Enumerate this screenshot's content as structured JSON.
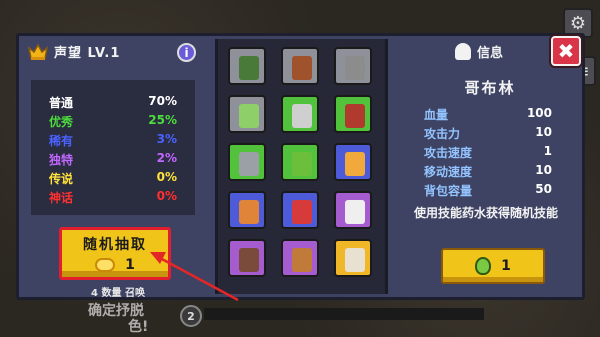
{
  "reputation": {
    "title": "声望 LV.1",
    "info_icon": "info-icon"
  },
  "rarities": [
    {
      "name": "普通",
      "value": "70%",
      "name_color": "#ffffff",
      "value_color": "#ffffff"
    },
    {
      "name": "优秀",
      "value": "25%",
      "name_color": "#4cdc3c",
      "value_color": "#4cdc3c"
    },
    {
      "name": "稀有",
      "value": "3%",
      "name_color": "#4a62ff",
      "value_color": "#4a62ff"
    },
    {
      "name": "独特",
      "value": "2%",
      "name_color": "#c267ff",
      "value_color": "#c267ff"
    },
    {
      "name": "传说",
      "value": "0%",
      "name_color": "#ffe23a",
      "value_color": "#ffe23a"
    },
    {
      "name": "神话",
      "value": "0%",
      "name_color": "#ff3030",
      "value_color": "#ff3030"
    }
  ],
  "draw_button": {
    "label": "随机抽取",
    "cost": "1"
  },
  "summon_note": "4 数量 召唤",
  "grid": [
    {
      "rarity": "gray",
      "sprite": "#4a7a3a"
    },
    {
      "rarity": "gray",
      "sprite": "#a0522d"
    },
    {
      "rarity": "gray",
      "sprite": "#8c8c8c"
    },
    {
      "rarity": "gray",
      "sprite": "#8fcf6a"
    },
    {
      "rarity": "green",
      "sprite": "#cfcfcf"
    },
    {
      "rarity": "green",
      "sprite": "#b03a2e"
    },
    {
      "rarity": "green",
      "sprite": "#9aa0a6"
    },
    {
      "rarity": "green",
      "sprite": "#6bbf3a"
    },
    {
      "rarity": "blue",
      "sprite": "#f2a93b"
    },
    {
      "rarity": "blue",
      "sprite": "#e0843a"
    },
    {
      "rarity": "blue",
      "sprite": "#d63a3a"
    },
    {
      "rarity": "purple",
      "sprite": "#efefef"
    },
    {
      "rarity": "purple",
      "sprite": "#7a4a3a"
    },
    {
      "rarity": "purple",
      "sprite": "#c07a3a"
    },
    {
      "rarity": "gold",
      "sprite": "#e8e0d0"
    }
  ],
  "info": {
    "title": "信息",
    "name": "哥布林",
    "stats": [
      {
        "label": "血量",
        "value": "100"
      },
      {
        "label": "攻击力",
        "value": "10"
      },
      {
        "label": "攻击速度",
        "value": "1"
      },
      {
        "label": "移动速度",
        "value": "10"
      },
      {
        "label": "背包容量",
        "value": "50"
      }
    ],
    "description": "使用技能药水获得随机技能",
    "potion_count": "1"
  },
  "bottom": {
    "badge": "2",
    "text_a": "确定抒脱",
    "text_b": "色!"
  },
  "colors": {
    "panel": "#3e4364",
    "close": "#d93448",
    "gold": "#f0c419",
    "highlight": "#e11d2e"
  }
}
